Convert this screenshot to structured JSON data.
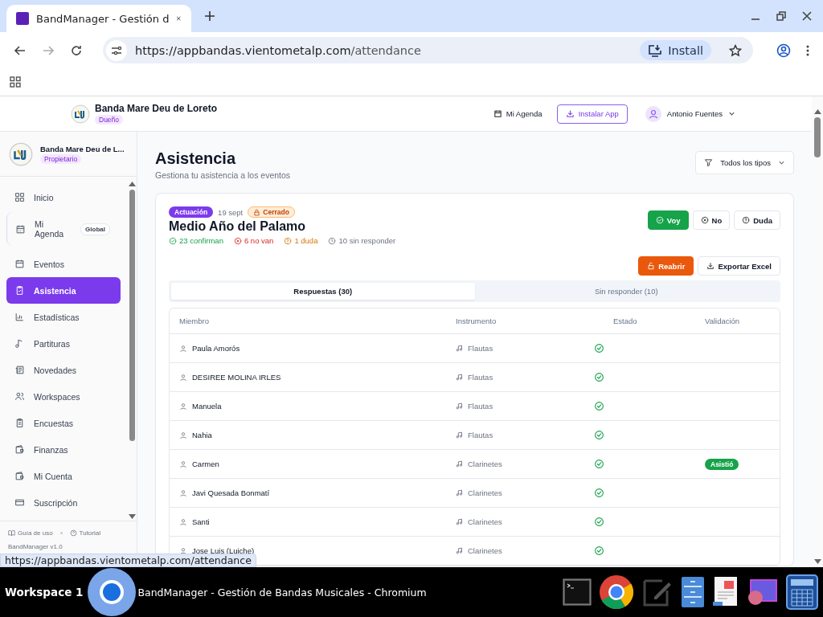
{
  "browser": {
    "tab_title": "BandManager - Gestión d",
    "url_host": "https://appbandas.vientometalp.com",
    "url_path": "/attendance",
    "install_label": "Install"
  },
  "header": {
    "org_name": "Banda Mare Deu de Loreto",
    "role": "Dueño",
    "agenda": "Mi Agenda",
    "install": "Instalar App",
    "user": "Antonio Fuentes"
  },
  "sidebar": {
    "org_name": "Banda Mare Deu de L...",
    "role": "Propietario",
    "items": [
      {
        "label": "Inicio",
        "selected": false
      },
      {
        "label": "Mi Agenda",
        "selected": false,
        "badge": "Global"
      },
      {
        "label": "Eventos",
        "selected": false
      },
      {
        "label": "Asistencia",
        "selected": true
      },
      {
        "label": "Estadísticas",
        "selected": false
      },
      {
        "label": "Partituras",
        "selected": false
      },
      {
        "label": "Novedades",
        "selected": false
      },
      {
        "label": "Workspaces",
        "selected": false
      },
      {
        "label": "Encuestas",
        "selected": false
      },
      {
        "label": "Finanzas",
        "selected": false
      },
      {
        "label": "Mi Cuenta",
        "selected": false
      },
      {
        "label": "Suscripción",
        "selected": false
      }
    ],
    "footer_links": [
      "Guía de uso",
      "Tutorial"
    ],
    "version": "BandManager v1.0"
  },
  "page": {
    "title": "Asistencia",
    "subtitle": "Gestiona tu asistencia a los eventos",
    "filter": "Todos los tipos"
  },
  "event": {
    "category": "Actuación",
    "date": "19 sept",
    "status": "Cerrado",
    "title": "Medio Año del Palamo",
    "stats": [
      {
        "kind": "confirm",
        "text": "23 confirman"
      },
      {
        "kind": "decline",
        "text": "6 no van"
      },
      {
        "kind": "maybe",
        "text": "1 duda"
      },
      {
        "kind": "pending",
        "text": "10 sin responder"
      }
    ],
    "responses": [
      {
        "kind": "yes",
        "label": "Voy",
        "selected": true
      },
      {
        "kind": "no",
        "label": "No",
        "selected": false
      },
      {
        "kind": "maybe",
        "label": "Duda",
        "selected": false
      }
    ],
    "actions": [
      {
        "kind": "reopen",
        "label": "Reabrir"
      },
      {
        "kind": "export",
        "label": "Exportar Excel"
      }
    ],
    "tabs": [
      {
        "label": "Respuestas (30)",
        "selected": true
      },
      {
        "label": "Sin responder (10)",
        "selected": false
      }
    ],
    "table": {
      "columns": [
        "Miembro",
        "Instrumento",
        "Estado",
        "Validación"
      ],
      "rows": [
        {
          "member": "Paula Amorós",
          "instrument": "Flautas",
          "attending": true
        },
        {
          "member": "DESIREE MOLINA IRLES",
          "instrument": "Flautas",
          "attending": true
        },
        {
          "member": "Manuela",
          "instrument": "Flautas",
          "attending": true
        },
        {
          "member": "Nahia",
          "instrument": "Flautas",
          "attending": true
        },
        {
          "member": "Carmen",
          "instrument": "Clarinetes",
          "attending": true,
          "validation": "Asistió"
        },
        {
          "member": "Javi Quesada Bonmatí",
          "instrument": "Clarinetes",
          "attending": true
        },
        {
          "member": "Santi",
          "instrument": "Clarinetes",
          "attending": true
        },
        {
          "member": "Jose Luis (Luiche)",
          "instrument": "Clarinetes",
          "attending": true
        }
      ]
    }
  },
  "status_url": "https://appbandas.vientometalp.com/attendance",
  "taskbar": {
    "workspace": "Workspace 1",
    "window_title": "BandManager - Gestión de Bandas Musicales - Chromium"
  }
}
